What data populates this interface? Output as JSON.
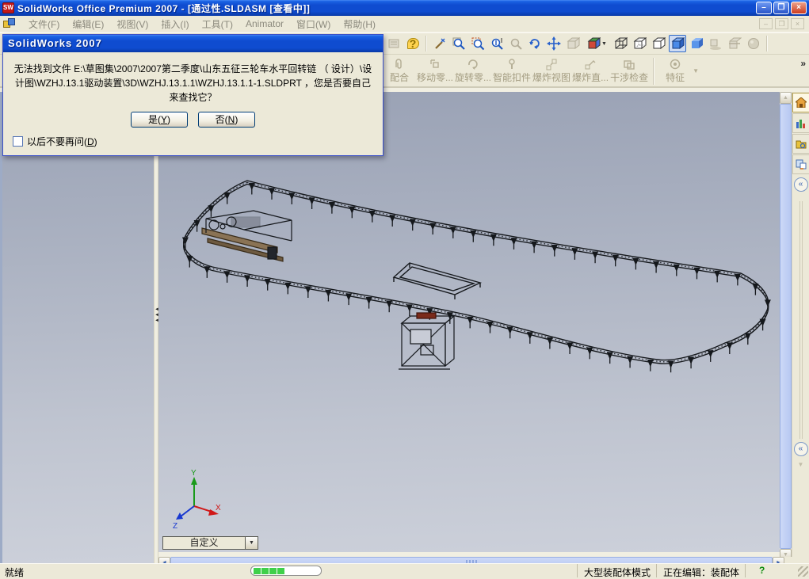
{
  "window": {
    "title": "SolidWorks Office Premium 2007 - [通过性.SLDASM [查看中]]"
  },
  "menu": {
    "items": [
      "文件(F)",
      "编辑(E)",
      "视图(V)",
      "插入(I)",
      "工具(T)",
      "Animator",
      "窗口(W)",
      "帮助(H)"
    ]
  },
  "assembly_toolbar": {
    "buttons": [
      "配合",
      "移动零...",
      "旋转零...",
      "智能扣件",
      "爆炸视图",
      "爆炸直...",
      "干涉检查",
      "特征"
    ],
    "overflow": "»"
  },
  "icons": {
    "help": "?",
    "dropdown": "▼",
    "collapse": "«",
    "scroll_up": "▲",
    "scroll_down": "▼",
    "scroll_left": "◄",
    "scroll_right": "►",
    "splitter_arrows": "◄◄◄",
    "minimize": "–",
    "restore": "❐",
    "close": "×"
  },
  "dialog": {
    "title": "SolidWorks 2007",
    "message": "无法找到文件 E:\\草图集\\2007\\2007第二季度\\山东五征三轮车水平回转链 （ 设计）\\设计图\\WZHJ.13.1驱动装置\\3D\\WZHJ.13.1.1\\WZHJ.13.1.1-1.SLDPRT ，您是否要自己来查找它？",
    "yes_prefix": "是(",
    "yes_key": "Y",
    "yes_suffix": ")",
    "no_prefix": "否(",
    "no_key": "N",
    "no_suffix": ")",
    "check_prefix": "以后不要再问(",
    "check_key": "D",
    "check_suffix": ")"
  },
  "viewport": {
    "view_combo": "自定义",
    "triad": {
      "x": "X",
      "y": "Y",
      "z": "Z"
    }
  },
  "statusbar": {
    "ready": "就绪",
    "mode": "大型装配体模式",
    "editing": "正在编辑：装配体",
    "help_mark": "?"
  }
}
